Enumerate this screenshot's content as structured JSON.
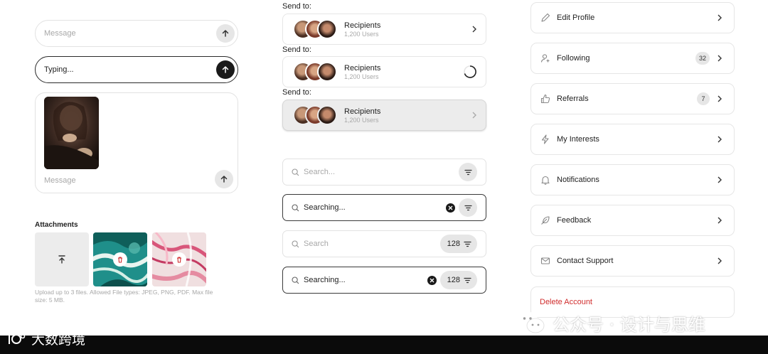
{
  "chat_input": {
    "empty_placeholder": "Message",
    "typing_value": "Typing...",
    "compose_placeholder": "Message"
  },
  "attachments": {
    "title": "Attachments",
    "hint": "Upload up to 3 files. Allowed File types: JPEG, PNG, PDF. Max file size: 5 MB."
  },
  "recipients": [
    {
      "label": "Send to:",
      "title": "Recipients",
      "subtitle": "1,200 Users",
      "state": "default"
    },
    {
      "label": "Send to:",
      "title": "Recipients",
      "subtitle": "1,200 Users",
      "state": "loading"
    },
    {
      "label": "Send to:",
      "title": "Recipients",
      "subtitle": "1,200 Users",
      "state": "hover"
    }
  ],
  "search": {
    "placeholder": "Search...",
    "searching_value": "Searching...",
    "placeholder_plain": "Search",
    "result_count": "128",
    "searching_value_2": "Searching..."
  },
  "menu": [
    {
      "label": "Edit Profile",
      "icon": "pencil-icon"
    },
    {
      "label": "Following",
      "icon": "user-plus-icon",
      "badge": "32"
    },
    {
      "label": "Referrals",
      "icon": "thumbs-up-icon",
      "badge": "7"
    },
    {
      "label": "My Interests",
      "icon": "lightning-icon"
    },
    {
      "label": "Notifications",
      "icon": "bell-icon"
    },
    {
      "label": "Feedback",
      "icon": "feather-icon"
    },
    {
      "label": "Contact Support",
      "icon": "mail-icon"
    },
    {
      "label": "Delete Account",
      "icon": "",
      "danger": true
    }
  ],
  "watermark": {
    "right_text": "公众号 · 设计与思维",
    "left_text": "大数跨境"
  },
  "colors": {
    "danger": "#d02c2c",
    "border": "#e2e2e2",
    "accent_dark": "#1a1a1a"
  }
}
